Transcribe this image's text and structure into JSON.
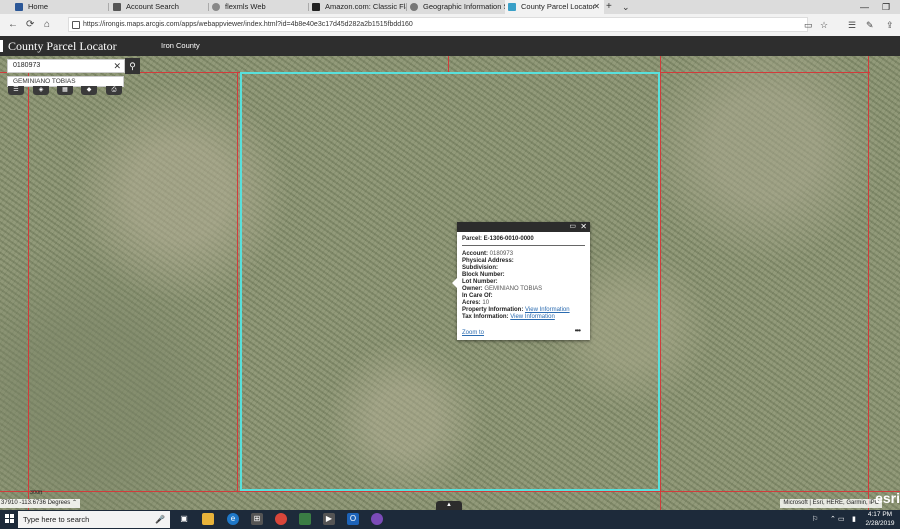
{
  "browser": {
    "tabs": [
      {
        "label": "Home",
        "icon_color": "#2b5797",
        "active": false
      },
      {
        "label": "Account Search",
        "icon_color": "#555555",
        "active": false
      },
      {
        "label": "flexmls Web",
        "icon_color": "#888888",
        "active": false
      },
      {
        "label": "Amazon.com: Classic Flame",
        "icon_color": "#222222",
        "active": false
      },
      {
        "label": "Geographic Information Sys",
        "icon_color": "#777777",
        "active": false
      },
      {
        "label": "County Parcel Locator",
        "icon_color": "#39a0c8",
        "active": true
      }
    ],
    "url": "https://irongis.maps.arcgis.com/apps/webappviewer/index.html?id=4b8e40e3c17d45d282a2b1515fbdd160"
  },
  "app": {
    "title": "County Parcel Locator",
    "subtitle": "Iron County"
  },
  "search": {
    "value": "0180973",
    "suggestion": "GEMINIANO TOBIAS"
  },
  "popup": {
    "title": "Parcel: E-1306-0010-0000",
    "fields": [
      {
        "label": "Account:",
        "value": "0180973"
      },
      {
        "label": "Physical Address:",
        "value": ""
      },
      {
        "label": "Subdivision:",
        "value": ""
      },
      {
        "label": "Block Number:",
        "value": ""
      },
      {
        "label": "Lot Number:",
        "value": ""
      },
      {
        "label": "Owner:",
        "value": "GEMINIANO TOBIAS"
      },
      {
        "label": "In Care Of:",
        "value": ""
      },
      {
        "label": "Acres:",
        "value": "10"
      }
    ],
    "property_label": "Property Information:",
    "property_link": "View Information",
    "tax_label": "Tax Information:",
    "tax_link": "View Information",
    "zoom_label": "Zoom to",
    "more": "•••"
  },
  "map": {
    "coords": "37910 -113.6736 Degrees",
    "scale": "300ft",
    "attribution": "Microsoft | Esri, HERE, Garmin, iPC",
    "esri_logo": "esri",
    "parcel_color": "#d23b3b",
    "selection_color": "#58e0dc"
  },
  "taskbar": {
    "search_placeholder": "Type here to search",
    "time": "4:17 PM",
    "date": "2/28/2019"
  }
}
